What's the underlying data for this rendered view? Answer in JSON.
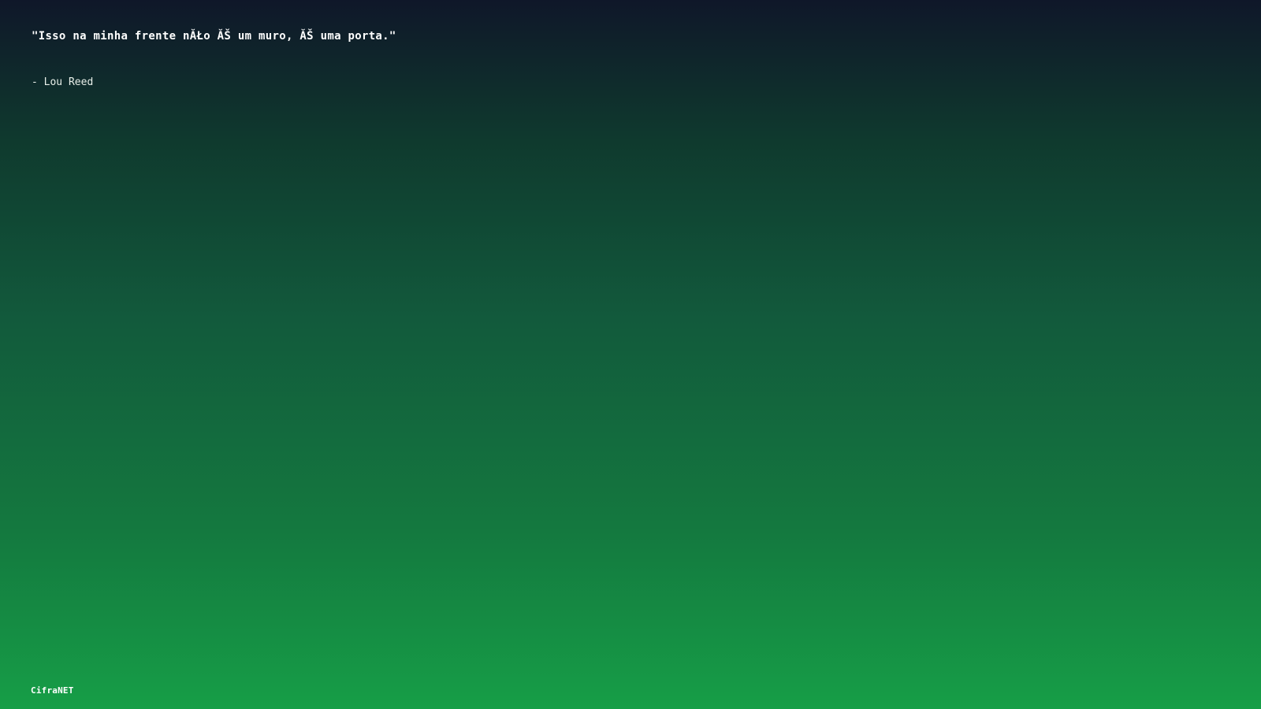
{
  "quote": {
    "text": "\"Isso na minha frente nĂŁo ĂŠ um muro, ĂŠ uma porta.\"",
    "author": "- Lou Reed"
  },
  "footer": {
    "brand": "CifraNET"
  },
  "colors": {
    "gradient_top": "#0f1729",
    "gradient_bottom": "#169e47",
    "text": "#ffffff"
  }
}
